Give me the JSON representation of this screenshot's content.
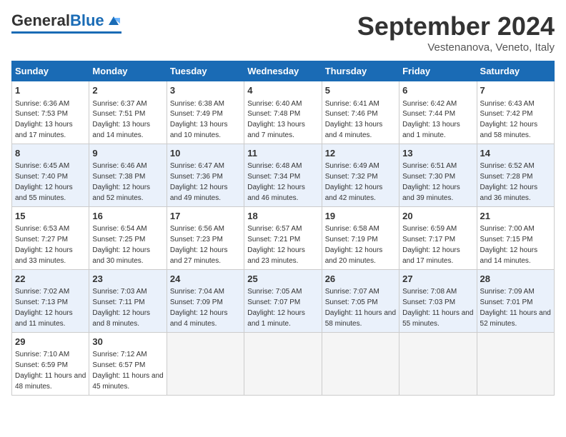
{
  "header": {
    "logo_text_general": "General",
    "logo_text_blue": "Blue",
    "month_title": "September 2024",
    "subtitle": "Vestenanova, Veneto, Italy"
  },
  "days_of_week": [
    "Sunday",
    "Monday",
    "Tuesday",
    "Wednesday",
    "Thursday",
    "Friday",
    "Saturday"
  ],
  "weeks": [
    [
      {
        "day": "1",
        "sunrise": "Sunrise: 6:36 AM",
        "sunset": "Sunset: 7:53 PM",
        "daylight": "Daylight: 13 hours and 17 minutes."
      },
      {
        "day": "2",
        "sunrise": "Sunrise: 6:37 AM",
        "sunset": "Sunset: 7:51 PM",
        "daylight": "Daylight: 13 hours and 14 minutes."
      },
      {
        "day": "3",
        "sunrise": "Sunrise: 6:38 AM",
        "sunset": "Sunset: 7:49 PM",
        "daylight": "Daylight: 13 hours and 10 minutes."
      },
      {
        "day": "4",
        "sunrise": "Sunrise: 6:40 AM",
        "sunset": "Sunset: 7:48 PM",
        "daylight": "Daylight: 13 hours and 7 minutes."
      },
      {
        "day": "5",
        "sunrise": "Sunrise: 6:41 AM",
        "sunset": "Sunset: 7:46 PM",
        "daylight": "Daylight: 13 hours and 4 minutes."
      },
      {
        "day": "6",
        "sunrise": "Sunrise: 6:42 AM",
        "sunset": "Sunset: 7:44 PM",
        "daylight": "Daylight: 13 hours and 1 minute."
      },
      {
        "day": "7",
        "sunrise": "Sunrise: 6:43 AM",
        "sunset": "Sunset: 7:42 PM",
        "daylight": "Daylight: 12 hours and 58 minutes."
      }
    ],
    [
      {
        "day": "8",
        "sunrise": "Sunrise: 6:45 AM",
        "sunset": "Sunset: 7:40 PM",
        "daylight": "Daylight: 12 hours and 55 minutes."
      },
      {
        "day": "9",
        "sunrise": "Sunrise: 6:46 AM",
        "sunset": "Sunset: 7:38 PM",
        "daylight": "Daylight: 12 hours and 52 minutes."
      },
      {
        "day": "10",
        "sunrise": "Sunrise: 6:47 AM",
        "sunset": "Sunset: 7:36 PM",
        "daylight": "Daylight: 12 hours and 49 minutes."
      },
      {
        "day": "11",
        "sunrise": "Sunrise: 6:48 AM",
        "sunset": "Sunset: 7:34 PM",
        "daylight": "Daylight: 12 hours and 46 minutes."
      },
      {
        "day": "12",
        "sunrise": "Sunrise: 6:49 AM",
        "sunset": "Sunset: 7:32 PM",
        "daylight": "Daylight: 12 hours and 42 minutes."
      },
      {
        "day": "13",
        "sunrise": "Sunrise: 6:51 AM",
        "sunset": "Sunset: 7:30 PM",
        "daylight": "Daylight: 12 hours and 39 minutes."
      },
      {
        "day": "14",
        "sunrise": "Sunrise: 6:52 AM",
        "sunset": "Sunset: 7:28 PM",
        "daylight": "Daylight: 12 hours and 36 minutes."
      }
    ],
    [
      {
        "day": "15",
        "sunrise": "Sunrise: 6:53 AM",
        "sunset": "Sunset: 7:27 PM",
        "daylight": "Daylight: 12 hours and 33 minutes."
      },
      {
        "day": "16",
        "sunrise": "Sunrise: 6:54 AM",
        "sunset": "Sunset: 7:25 PM",
        "daylight": "Daylight: 12 hours and 30 minutes."
      },
      {
        "day": "17",
        "sunrise": "Sunrise: 6:56 AM",
        "sunset": "Sunset: 7:23 PM",
        "daylight": "Daylight: 12 hours and 27 minutes."
      },
      {
        "day": "18",
        "sunrise": "Sunrise: 6:57 AM",
        "sunset": "Sunset: 7:21 PM",
        "daylight": "Daylight: 12 hours and 23 minutes."
      },
      {
        "day": "19",
        "sunrise": "Sunrise: 6:58 AM",
        "sunset": "Sunset: 7:19 PM",
        "daylight": "Daylight: 12 hours and 20 minutes."
      },
      {
        "day": "20",
        "sunrise": "Sunrise: 6:59 AM",
        "sunset": "Sunset: 7:17 PM",
        "daylight": "Daylight: 12 hours and 17 minutes."
      },
      {
        "day": "21",
        "sunrise": "Sunrise: 7:00 AM",
        "sunset": "Sunset: 7:15 PM",
        "daylight": "Daylight: 12 hours and 14 minutes."
      }
    ],
    [
      {
        "day": "22",
        "sunrise": "Sunrise: 7:02 AM",
        "sunset": "Sunset: 7:13 PM",
        "daylight": "Daylight: 12 hours and 11 minutes."
      },
      {
        "day": "23",
        "sunrise": "Sunrise: 7:03 AM",
        "sunset": "Sunset: 7:11 PM",
        "daylight": "Daylight: 12 hours and 8 minutes."
      },
      {
        "day": "24",
        "sunrise": "Sunrise: 7:04 AM",
        "sunset": "Sunset: 7:09 PM",
        "daylight": "Daylight: 12 hours and 4 minutes."
      },
      {
        "day": "25",
        "sunrise": "Sunrise: 7:05 AM",
        "sunset": "Sunset: 7:07 PM",
        "daylight": "Daylight: 12 hours and 1 minute."
      },
      {
        "day": "26",
        "sunrise": "Sunrise: 7:07 AM",
        "sunset": "Sunset: 7:05 PM",
        "daylight": "Daylight: 11 hours and 58 minutes."
      },
      {
        "day": "27",
        "sunrise": "Sunrise: 7:08 AM",
        "sunset": "Sunset: 7:03 PM",
        "daylight": "Daylight: 11 hours and 55 minutes."
      },
      {
        "day": "28",
        "sunrise": "Sunrise: 7:09 AM",
        "sunset": "Sunset: 7:01 PM",
        "daylight": "Daylight: 11 hours and 52 minutes."
      }
    ],
    [
      {
        "day": "29",
        "sunrise": "Sunrise: 7:10 AM",
        "sunset": "Sunset: 6:59 PM",
        "daylight": "Daylight: 11 hours and 48 minutes."
      },
      {
        "day": "30",
        "sunrise": "Sunrise: 7:12 AM",
        "sunset": "Sunset: 6:57 PM",
        "daylight": "Daylight: 11 hours and 45 minutes."
      },
      null,
      null,
      null,
      null,
      null
    ]
  ]
}
